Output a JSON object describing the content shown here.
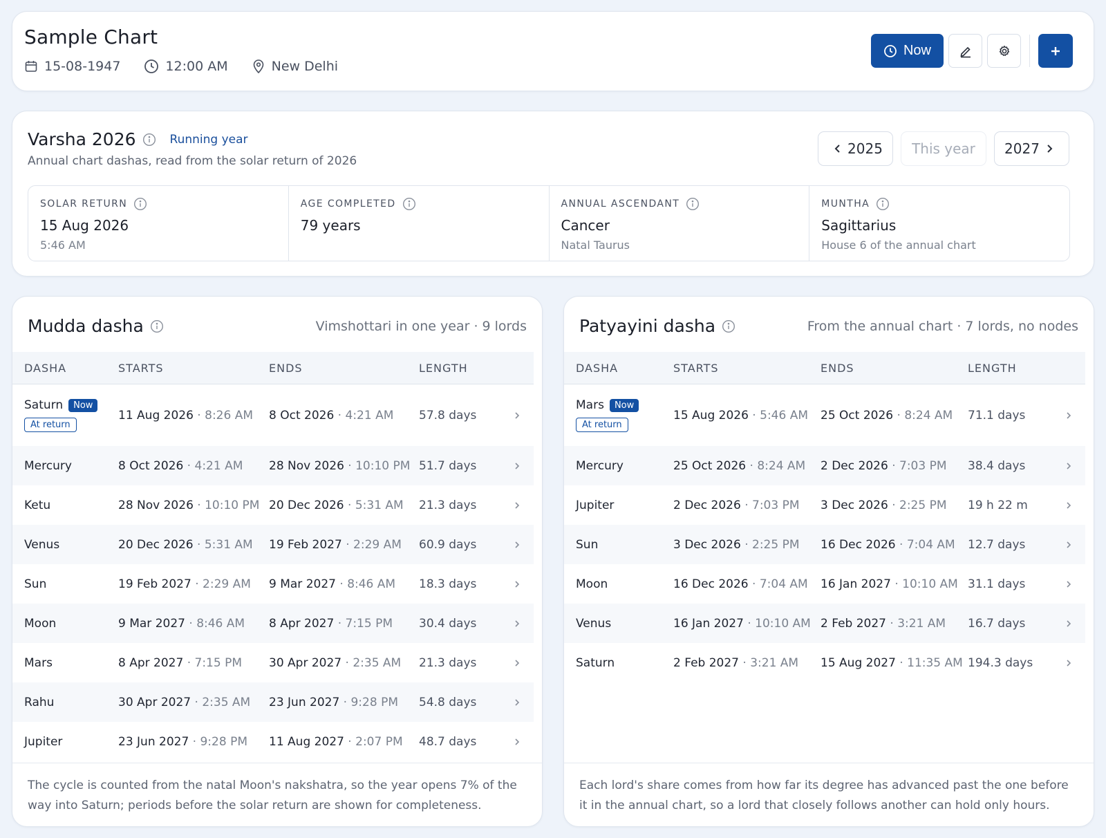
{
  "chart": {
    "title": "Sample Chart",
    "date": "15-08-1947",
    "time": "12:00 AM",
    "place": "New Delhi"
  },
  "header_actions": {
    "now_label": "Now"
  },
  "varsha": {
    "title": "Varsha 2026",
    "running_label": "Running year",
    "subtitle": "Annual chart dashas, read from the solar return of 2026",
    "nav": {
      "prev": "2025",
      "this": "This year",
      "next": "2027"
    },
    "stats": [
      {
        "label": "SOLAR RETURN",
        "value": "15 Aug 2026",
        "sub": "5:46 AM"
      },
      {
        "label": "AGE COMPLETED",
        "value": "79 years",
        "sub": ""
      },
      {
        "label": "ANNUAL ASCENDANT",
        "value": "Cancer",
        "sub": "Natal Taurus"
      },
      {
        "label": "MUNTHA",
        "value": "Sagittarius",
        "sub": "House 6 of the annual chart"
      }
    ]
  },
  "columns": {
    "dasha": "DASHA",
    "starts": "STARTS",
    "ends": "ENDS",
    "length": "LENGTH"
  },
  "badges": {
    "now": "Now",
    "at_return": "At return"
  },
  "mudda": {
    "title": "Mudda dasha",
    "description": "Vimshottari in one year · 9 lords",
    "rows": [
      {
        "lord": "Saturn",
        "start_date": "11 Aug 2026",
        "start_time": "8:26 AM",
        "end_date": "8 Oct 2026",
        "end_time": "4:21 AM",
        "length": "57.8 days"
      },
      {
        "lord": "Mercury",
        "start_date": "8 Oct 2026",
        "start_time": "4:21 AM",
        "end_date": "28 Nov 2026",
        "end_time": "10:10 PM",
        "length": "51.7 days"
      },
      {
        "lord": "Ketu",
        "start_date": "28 Nov 2026",
        "start_time": "10:10 PM",
        "end_date": "20 Dec 2026",
        "end_time": "5:31 AM",
        "length": "21.3 days"
      },
      {
        "lord": "Venus",
        "start_date": "20 Dec 2026",
        "start_time": "5:31 AM",
        "end_date": "19 Feb 2027",
        "end_time": "2:29 AM",
        "length": "60.9 days"
      },
      {
        "lord": "Sun",
        "start_date": "19 Feb 2027",
        "start_time": "2:29 AM",
        "end_date": "9 Mar 2027",
        "end_time": "8:46 AM",
        "length": "18.3 days"
      },
      {
        "lord": "Moon",
        "start_date": "9 Mar 2027",
        "start_time": "8:46 AM",
        "end_date": "8 Apr 2027",
        "end_time": "7:15 PM",
        "length": "30.4 days"
      },
      {
        "lord": "Mars",
        "start_date": "8 Apr 2027",
        "start_time": "7:15 PM",
        "end_date": "30 Apr 2027",
        "end_time": "2:35 AM",
        "length": "21.3 days"
      },
      {
        "lord": "Rahu",
        "start_date": "30 Apr 2027",
        "start_time": "2:35 AM",
        "end_date": "23 Jun 2027",
        "end_time": "9:28 PM",
        "length": "54.8 days"
      },
      {
        "lord": "Jupiter",
        "start_date": "23 Jun 2027",
        "start_time": "9:28 PM",
        "end_date": "11 Aug 2027",
        "end_time": "2:07 PM",
        "length": "48.7 days"
      }
    ],
    "footnote": "The cycle is counted from the natal Moon's nakshatra, so the year opens 7% of the way into Saturn; periods before the solar return are shown for completeness."
  },
  "patyayini": {
    "title": "Patyayini dasha",
    "description": "From the annual chart · 7 lords, no nodes",
    "rows": [
      {
        "lord": "Mars",
        "start_date": "15 Aug 2026",
        "start_time": "5:46 AM",
        "end_date": "25 Oct 2026",
        "end_time": "8:24 AM",
        "length": "71.1 days"
      },
      {
        "lord": "Mercury",
        "start_date": "25 Oct 2026",
        "start_time": "8:24 AM",
        "end_date": "2 Dec 2026",
        "end_time": "7:03 PM",
        "length": "38.4 days"
      },
      {
        "lord": "Jupiter",
        "start_date": "2 Dec 2026",
        "start_time": "7:03 PM",
        "end_date": "3 Dec 2026",
        "end_time": "2:25 PM",
        "length": "19 h 22 m"
      },
      {
        "lord": "Sun",
        "start_date": "3 Dec 2026",
        "start_time": "2:25 PM",
        "end_date": "16 Dec 2026",
        "end_time": "7:04 AM",
        "length": "12.7 days"
      },
      {
        "lord": "Moon",
        "start_date": "16 Dec 2026",
        "start_time": "7:04 AM",
        "end_date": "16 Jan 2027",
        "end_time": "10:10 AM",
        "length": "31.1 days"
      },
      {
        "lord": "Venus",
        "start_date": "16 Jan 2027",
        "start_time": "10:10 AM",
        "end_date": "2 Feb 2027",
        "end_time": "3:21 AM",
        "length": "16.7 days"
      },
      {
        "lord": "Saturn",
        "start_date": "2 Feb 2027",
        "start_time": "3:21 AM",
        "end_date": "15 Aug 2027",
        "end_time": "11:35 AM",
        "length": "194.3 days"
      }
    ],
    "footnote": "Each lord's share comes from how far its degree has advanced past the one before it in the annual chart, so a lord that closely follows another can hold only hours."
  }
}
